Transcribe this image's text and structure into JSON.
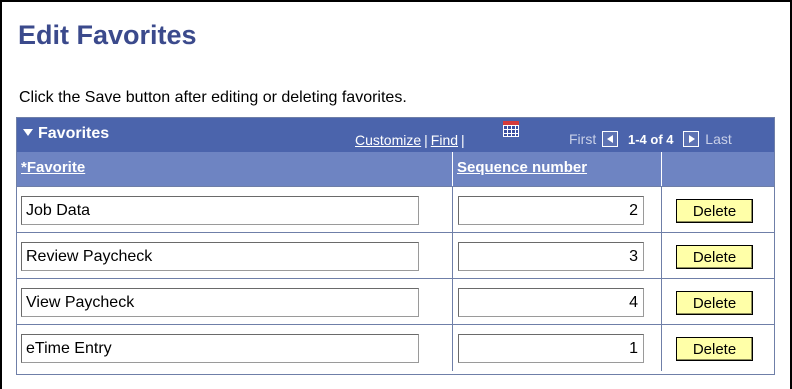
{
  "page": {
    "title": "Edit Favorites",
    "instructions": "Click the Save button after editing or deleting favorites."
  },
  "grid": {
    "title": "Favorites",
    "customize_label": "Customize",
    "find_label": "Find",
    "nav": {
      "first": "First",
      "range": "1-4 of 4",
      "last": "Last"
    },
    "columns": {
      "favorite": "*Favorite",
      "sequence": "Sequence number"
    },
    "rows": [
      {
        "favorite": "Job Data",
        "sequence": "2",
        "delete_label": "Delete"
      },
      {
        "favorite": "Review Paycheck",
        "sequence": "3",
        "delete_label": "Delete"
      },
      {
        "favorite": "View Paycheck",
        "sequence": "4",
        "delete_label": "Delete"
      },
      {
        "favorite": "eTime Entry",
        "sequence": "1",
        "delete_label": "Delete"
      }
    ]
  },
  "colors": {
    "header_bg": "#4b64ac",
    "column_bg": "#6e84c2",
    "title": "#3b4a8c",
    "button": "#ffffa8"
  }
}
